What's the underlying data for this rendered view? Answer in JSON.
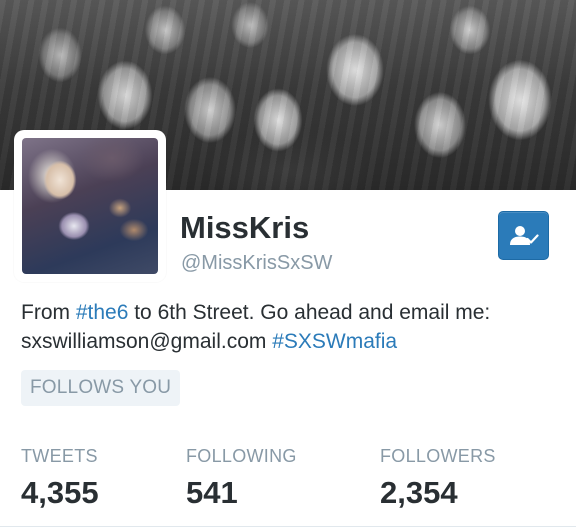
{
  "profile": {
    "name": "MissKris",
    "handle": "@MissKrisSxSW",
    "bio": {
      "part1": "From ",
      "tag1": "#the6",
      "part2": " to 6th Street. Go ahead and email me: sxswilliamson@gmail.com ",
      "tag2": "#SXSWmafia"
    },
    "follows_you": "FOLLOWS YOU"
  },
  "stats": {
    "tweets": {
      "label": "TWEETS",
      "value": "4,355"
    },
    "following": {
      "label": "FOLLOWING",
      "value": "541"
    },
    "followers": {
      "label": "FOLLOWERS",
      "value": "2,354"
    }
  },
  "icons": {
    "follow_button": "user-check-icon"
  },
  "colors": {
    "accent": "#2b7bb9",
    "text": "#292f33",
    "muted": "#8899a6",
    "badge_bg": "#eef3f7"
  }
}
